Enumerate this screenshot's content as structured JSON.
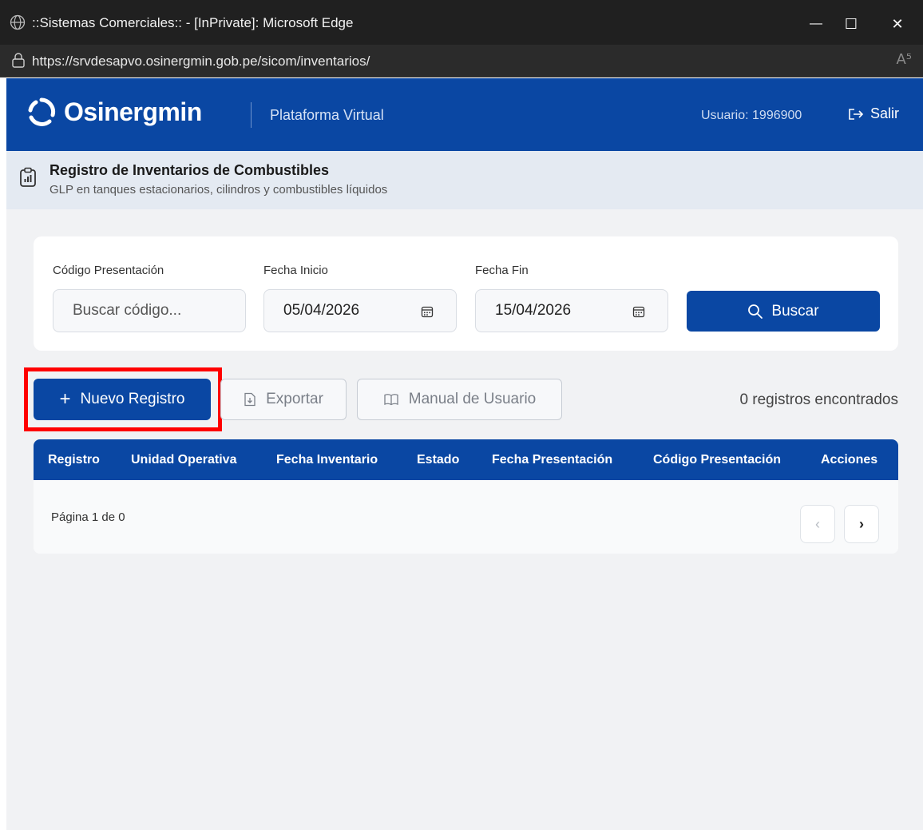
{
  "browser": {
    "window_title": "::Sistemas Comerciales:: - [InPrivate]: Microsoft Edge",
    "url": "https://srvdesapvo.osinergmin.gob.pe/sicom/inventarios/",
    "read_aloud_label": "A⁵",
    "minimize_glyph": "—",
    "maximize_glyph": "☐",
    "close_glyph": "✕"
  },
  "header": {
    "brand": "Osinergmin",
    "platform": "Plataforma Virtual",
    "user": "Usuario: 1996900",
    "logout_label": "Salir"
  },
  "page": {
    "title": "Registro de Inventarios de Combustibles",
    "subtitle": "GLP en tanques estacionarios, cilindros y combustibles líquidos"
  },
  "filters": {
    "code_label": "Código Presentación",
    "code_placeholder": "Buscar código...",
    "start_label": "Fecha Inicio",
    "start_value": "05/04/2026",
    "end_label": "Fecha Fin",
    "end_value": "15/04/2026",
    "search_label": "Buscar"
  },
  "actions": {
    "new_icon": "+",
    "new_label": "Nuevo Registro",
    "export_label": "Exportar",
    "manual_label": "Manual de Usuario",
    "count_text": "0 registros encontrados"
  },
  "table": {
    "columns": [
      "Registro",
      "Unidad Operativa",
      "Fecha Inventario",
      "Estado",
      "Fecha Presentación",
      "Código Presentación",
      "Acciones"
    ],
    "rows": [],
    "pagination_text": "Página 1 de 0",
    "prev_glyph": "‹",
    "next_glyph": "›"
  },
  "colors": {
    "brand_blue": "#0a47a3",
    "highlight_red": "#ff0000",
    "chrome_dark": "#202020"
  },
  "icons": [
    "globe-icon",
    "lock-icon",
    "osinergmin-logo-icon",
    "logout-icon",
    "clipboard-chart-icon",
    "calendar-icon",
    "search-icon",
    "plus-icon",
    "file-export-icon",
    "book-icon",
    "chevron-left-icon",
    "chevron-right-icon"
  ]
}
